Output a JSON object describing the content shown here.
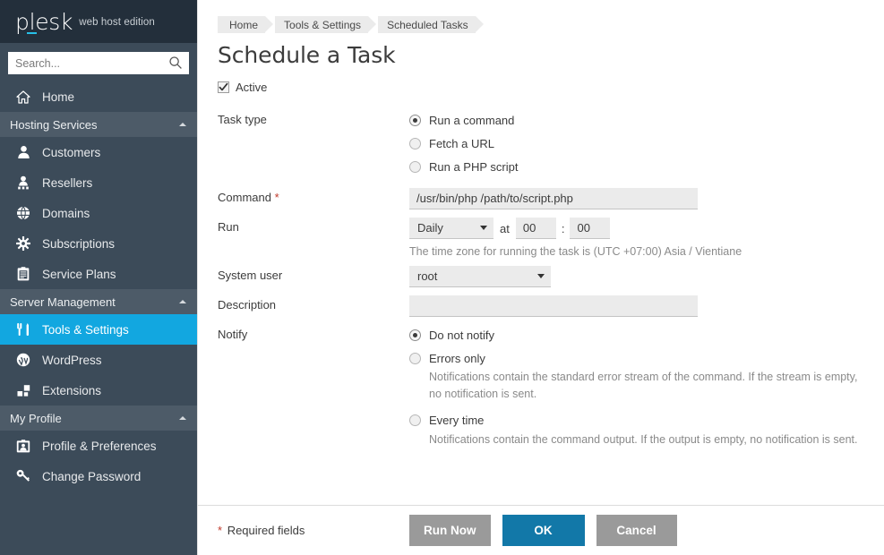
{
  "brand": {
    "logo_text": "plesk",
    "edition": "web host edition"
  },
  "search": {
    "placeholder": "Search...",
    "value": "",
    "icon": "search-icon"
  },
  "sidebar": {
    "home": {
      "label": "Home",
      "icon": "home-icon"
    },
    "groups": [
      {
        "title": "Hosting Services",
        "collapse_icon": "caret-up-icon",
        "items": [
          {
            "label": "Customers",
            "icon": "user-icon"
          },
          {
            "label": "Resellers",
            "icon": "users-icon"
          },
          {
            "label": "Domains",
            "icon": "globe-icon"
          },
          {
            "label": "Subscriptions",
            "icon": "gear-icon"
          },
          {
            "label": "Service Plans",
            "icon": "clipboard-icon"
          }
        ]
      },
      {
        "title": "Server Management",
        "collapse_icon": "caret-up-icon",
        "items": [
          {
            "label": "Tools & Settings",
            "icon": "tools-icon",
            "active": true
          },
          {
            "label": "WordPress",
            "icon": "wordpress-icon"
          },
          {
            "label": "Extensions",
            "icon": "blocks-icon"
          }
        ]
      },
      {
        "title": "My Profile",
        "collapse_icon": "caret-up-icon",
        "items": [
          {
            "label": "Profile & Preferences",
            "icon": "profile-card-icon"
          },
          {
            "label": "Change Password",
            "icon": "key-icon"
          }
        ]
      }
    ]
  },
  "breadcrumb": [
    {
      "label": "Home"
    },
    {
      "label": "Tools & Settings"
    },
    {
      "label": "Scheduled Tasks"
    }
  ],
  "page": {
    "title": "Schedule a Task"
  },
  "form": {
    "active": {
      "label": "Active",
      "checked": true
    },
    "task_type": {
      "label": "Task type",
      "options": [
        {
          "label": "Run a command",
          "selected": true
        },
        {
          "label": "Fetch a URL",
          "selected": false
        },
        {
          "label": "Run a PHP script",
          "selected": false
        }
      ]
    },
    "command": {
      "label": "Command",
      "required_mark": "*",
      "value": "/usr/bin/php /path/to/script.php"
    },
    "run": {
      "label": "Run",
      "frequency": "Daily",
      "at_word": "at",
      "hour": "00",
      "colon": ":",
      "minute": "00",
      "timezone_hint": "The time zone for running the task is (UTC +07:00) Asia / Vientiane"
    },
    "system_user": {
      "label": "System user",
      "value": "root"
    },
    "description": {
      "label": "Description",
      "value": ""
    },
    "notify": {
      "label": "Notify",
      "options": [
        {
          "label": "Do not notify",
          "selected": true,
          "description": ""
        },
        {
          "label": "Errors only",
          "selected": false,
          "description": "Notifications contain the standard error stream of the command. If the stream is empty, no notification is sent."
        },
        {
          "label": "Every time",
          "selected": false,
          "description": "Notifications contain the command output. If the output is empty, no notification is sent."
        }
      ]
    }
  },
  "footer": {
    "required_star": "*",
    "required_text": "Required fields",
    "buttons": {
      "run_now": "Run Now",
      "ok": "OK",
      "cancel": "Cancel"
    }
  },
  "colors": {
    "sidebar_bg": "#3c4b59",
    "brand_bg": "#232f3b",
    "group_header_bg": "#4d5b68",
    "accent_cyan": "#12a7e0",
    "logo_underline": "#27c0e8",
    "primary_button": "#1278a8",
    "gray_button": "#9a9a9a",
    "input_bg": "#ebebeb",
    "required_red": "#c0392b"
  }
}
